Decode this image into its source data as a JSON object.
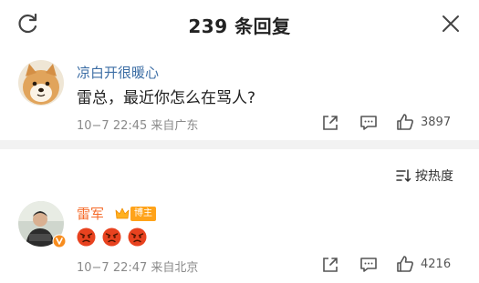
{
  "header": {
    "title": "239 条回复"
  },
  "comments": [
    {
      "username": "凉白开很暖心",
      "text": "雷总，最近你怎么在骂人?",
      "meta": "10−7 22:45 来自广东",
      "likes": "3897"
    },
    {
      "username": "雷军",
      "badge": "博主",
      "emojis": [
        "angry-face",
        "angry-face",
        "angry-face"
      ],
      "meta": "10−7 22:47 来自北京",
      "likes": "4216"
    }
  ],
  "sort": {
    "label": "按热度"
  },
  "colors": {
    "username": "#3d6ea5",
    "badge": "#ffa31a",
    "verified": "#f78c1e",
    "meta": "#8a8a8a"
  }
}
